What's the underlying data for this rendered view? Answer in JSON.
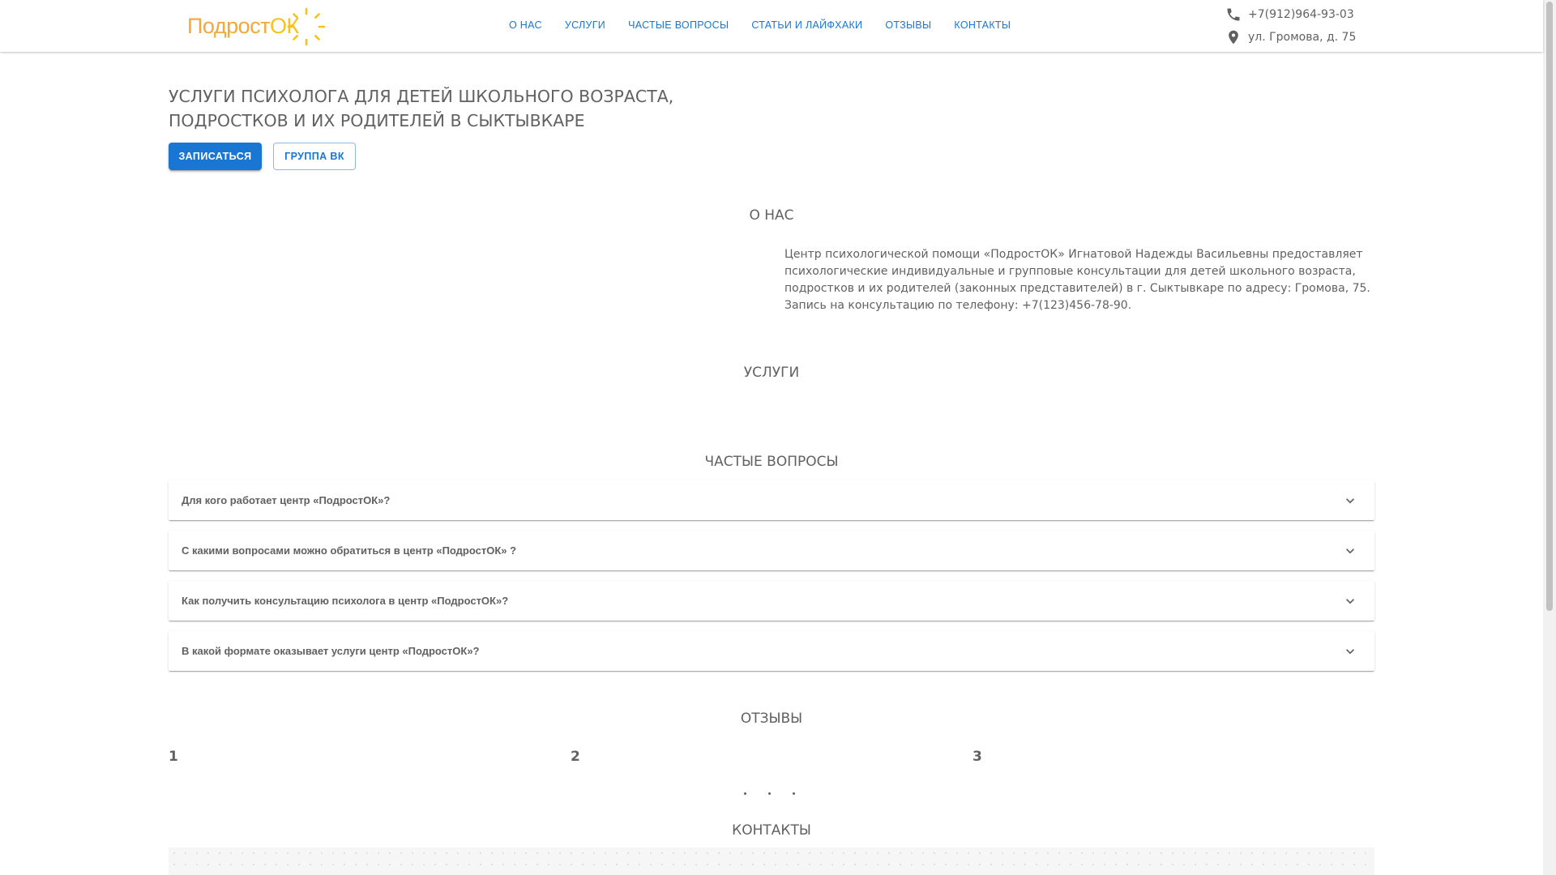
{
  "header": {
    "logo": {
      "text": "Подрост",
      "accent": "ОК"
    },
    "nav": [
      {
        "label": "О НАС"
      },
      {
        "label": "УСЛУГИ"
      },
      {
        "label": "ЧАСТЫЕ ВОПРОСЫ"
      },
      {
        "label": "СТАТЬИ И ЛАЙФХАКИ"
      },
      {
        "label": "ОТЗЫВЫ"
      },
      {
        "label": "КОНТАКТЫ"
      }
    ],
    "phone": "+7(912)964-93-03",
    "address": "ул. Громова, д. 75",
    "phone_icon": "phone-icon",
    "address_icon": "map-pin-icon"
  },
  "hero": {
    "title_line1": "УСЛУГИ ПСИХОЛОГА ДЛЯ ДЕТЕЙ ШКОЛЬНОГО ВОЗРАСТА,",
    "title_line2": "ПОДРОСТКОВ И ИХ РОДИТЕЛЕЙ В СЫКТЫВКАРЕ",
    "primary_button": "ЗАПИСАТЬСЯ",
    "secondary_button": "ГРУППА ВК"
  },
  "about": {
    "title": "О НАС",
    "text": "Центр психологической помощи «ПодростОК» Игнатовой Надежды Васильевны предоставляет психологические индивидуальные и групповые консультации для детей школьного возраста, подростков и их родителей (законных представителей) в г. Сыктывкаре по адресу: Громова, 75. Запись на консультацию по телефону: +7(123)456-78-90."
  },
  "services": {
    "title": "УСЛУГИ"
  },
  "faq": {
    "title": "ЧАСТЫЕ ВОПРОСЫ",
    "items": [
      {
        "question": "Для кого работает центр «ПодростОК»?"
      },
      {
        "question": "С какими вопросами можно обратиться в центр «ПодростОК» ?"
      },
      {
        "question": "Как получить консультацию психолога в центр «ПодростОК»?"
      },
      {
        "question": "В какой формате оказывает услуги центр «ПодростОК»?"
      }
    ],
    "expand_icon": "chevron-down-icon"
  },
  "reviews": {
    "title": "ОТЗЫВЫ",
    "cards": [
      {
        "label": "1"
      },
      {
        "label": "2"
      },
      {
        "label": "3"
      }
    ]
  },
  "contacts": {
    "title": "КОНТАКТЫ"
  },
  "colors": {
    "primary": "#1976d2",
    "text": "#616161",
    "logo_orange": "#f4a73b",
    "logo_yellow": "#f7c21a"
  }
}
